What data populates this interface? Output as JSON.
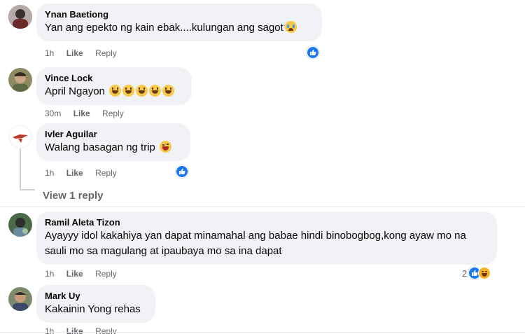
{
  "comments": [
    {
      "author": "Ynan Baetiong",
      "text": "Yan ang epekto ng kain ebak....kulungan ang sagot",
      "emojis": [
        "cry"
      ],
      "time": "1h",
      "like": "Like",
      "reply": "Reply",
      "reactions": {
        "count": "",
        "types": [
          "like"
        ]
      },
      "avatar_color": "#7a6a6a"
    },
    {
      "author": "Vince Lock",
      "text": "April Ngayon",
      "emojis": [
        "grin",
        "grin",
        "grin",
        "grin",
        "grin"
      ],
      "time": "30m",
      "like": "Like",
      "reply": "Reply",
      "reactions": {
        "count": "",
        "types": []
      },
      "avatar_color": "#8d8a62"
    },
    {
      "author": "Ivler Aguilar",
      "text": "Walang basagan ng trip",
      "emojis": [
        "wink"
      ],
      "time": "1h",
      "like": "Like",
      "reply": "Reply",
      "reactions": {
        "count": "",
        "types": [
          "like"
        ]
      },
      "avatar_color": "#c0392b"
    },
    {
      "author": "Ramil Aleta Tizon",
      "text": "Ayayyy idol kakahiya yan dapat minamahal ang babae hindi binobogbog,kong ayaw mo na sauli mo sa magulang at ipaubaya mo sa ina dapat",
      "emojis": [],
      "time": "1h",
      "like": "Like",
      "reply": "Reply",
      "reactions": {
        "count": "2",
        "types": [
          "like",
          "haha"
        ]
      },
      "avatar_color": "#4a6b4a"
    },
    {
      "author": "Mark Uy",
      "text": "Kakainin Yong rehas",
      "emojis": [],
      "time": "1h",
      "like": "Like",
      "reply": "Reply",
      "reactions": {
        "count": "",
        "types": []
      },
      "avatar_color": "#6a7a5a"
    }
  ],
  "view_replies": "View 1 reply",
  "colors": {
    "bubble": "#f0f2f5",
    "like_blue": "#1877f2",
    "meta_gray": "#65676b"
  }
}
